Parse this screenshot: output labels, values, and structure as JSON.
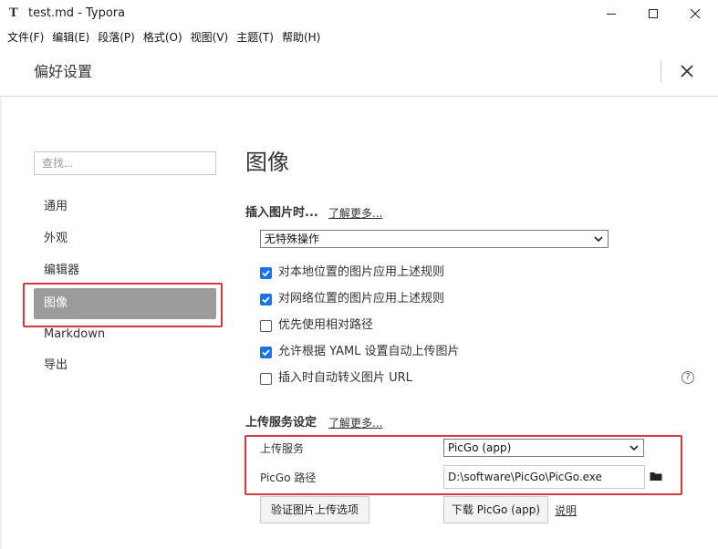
{
  "window": {
    "app_icon_glyph": "T",
    "title": "test.md - Typora"
  },
  "menu": [
    "文件(F)",
    "编辑(E)",
    "段落(P)",
    "格式(O)",
    "视图(V)",
    "主题(T)",
    "帮助(H)"
  ],
  "prefs": {
    "title": "偏好设置",
    "close_glyph": "✕"
  },
  "sidebar": {
    "search_placeholder": "查找...",
    "items": [
      {
        "label": "通用"
      },
      {
        "label": "外观"
      },
      {
        "label": "编辑器"
      },
      {
        "label": "图像",
        "active": true
      },
      {
        "label": "Markdown"
      },
      {
        "label": "导出"
      }
    ]
  },
  "image_section": {
    "title": "图像",
    "insert": {
      "label": "插入图片时...",
      "learn_more": "了解更多...",
      "select_value": "无特殊操作"
    },
    "checks": [
      {
        "label": "对本地位置的图片应用上述规则",
        "checked": true
      },
      {
        "label": "对网络位置的图片应用上述规则",
        "checked": true
      },
      {
        "label": "优先使用相对路径",
        "checked": false
      },
      {
        "label": "允许根据 YAML 设置自动上传图片",
        "checked": true
      },
      {
        "label": "插入时自动转义图片 URL",
        "checked": false
      }
    ],
    "help_glyph": "?",
    "upload": {
      "label": "上传服务设定",
      "learn_more": "了解更多...",
      "service_label": "上传服务",
      "service_value": "PicGo (app)",
      "path_label": "PicGo 路径",
      "path_value": "D:\\software\\PicGo\\PicGo.exe",
      "verify_button": "验证图片上传选项",
      "download_button": "下载 PicGo (app)",
      "explain_link": "说明"
    }
  },
  "colors": {
    "highlight_red": "#d9363e",
    "active_nav": "#9b9b9b",
    "checkbox_blue": "#1a73e8"
  }
}
